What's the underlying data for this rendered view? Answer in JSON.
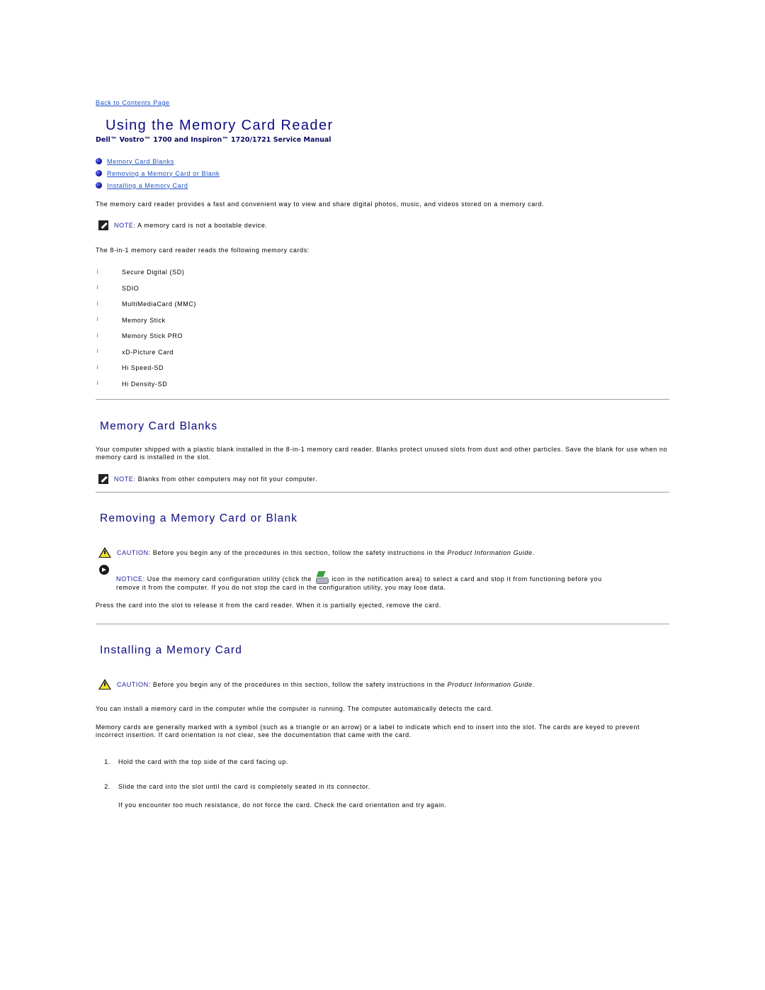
{
  "nav": {
    "back_link": "Back to Contents Page"
  },
  "header": {
    "title": "Using the Memory Card Reader",
    "subtitle": "Dell™ Vostro™ 1700 and Inspiron™ 1720/1721 Service Manual"
  },
  "toc": [
    {
      "label": "Memory Card Blanks"
    },
    {
      "label": "Removing a Memory Card or Blank"
    },
    {
      "label": "Installing a Memory Card"
    }
  ],
  "intro": {
    "paragraph": "The memory card reader provides a fast and convenient way to view and share digital photos, music, and videos stored on a memory card.",
    "note_label": "NOTE:",
    "note_text": " A memory card is not a bootable device.",
    "list_intro": "The 8-in-1 memory card reader reads the following memory cards:",
    "bullet_glyph": "l",
    "cards": [
      "Secure Digital (SD)",
      "SDIO",
      "MultiMediaCard (MMC)",
      "Memory Stick",
      "Memory Stick PRO",
      "xD-Picture Card",
      "Hi Speed-SD",
      "Hi Density-SD"
    ]
  },
  "blanks": {
    "heading": "Memory Card Blanks",
    "paragraph": "Your computer shipped with a plastic blank installed in the 8-in-1 memory card reader. Blanks protect unused slots from dust and other particles. Save the blank for use when no memory card is installed in the slot.",
    "note_label": "NOTE:",
    "note_text": " Blanks from other computers may not fit your computer."
  },
  "removing": {
    "heading": "Removing a Memory Card or Blank",
    "caution_label": "CAUTION:",
    "caution_text": " Before you begin any of the procedures in this section, follow the safety instructions in the ",
    "caution_guide": "Product Information Guide",
    "caution_end": ".",
    "notice_label": "NOTICE:",
    "notice_text_1": " Use the memory card configuration utility (click the ",
    "notice_text_2": " icon in the notification area) to select a card and stop it from functioning before you",
    "notice_text_3": "remove it from the computer. If you do not stop the card in the configuration utility, you may lose data.",
    "paragraph": "Press the card into the slot to release it from the card reader. When it is partially ejected, remove the card."
  },
  "installing": {
    "heading": "Installing a Memory Card",
    "caution_label": "CAUTION:",
    "caution_text": " Before you begin any of the procedures in this section, follow the safety instructions in the ",
    "caution_guide": "Product Information Guide",
    "caution_end": ".",
    "paragraph_1": "You can install a memory card in the computer while the computer is running. The computer automatically detects the card.",
    "paragraph_2": "Memory cards are generally marked with a symbol (such as a triangle or an arrow) or a label to indicate which end to insert into the slot. The cards are keyed to prevent incorrect insertion. If card orientation is not clear, see the documentation that came with the card.",
    "steps": [
      {
        "num": "1.",
        "text": "Hold the card with the top side of the card facing up."
      },
      {
        "num": "2.",
        "text": "Slide the card into the slot until the card is completely seated in its connector."
      }
    ],
    "step_note": "If you encounter too much resistance, do not force the card. Check the card orientation and try again."
  }
}
